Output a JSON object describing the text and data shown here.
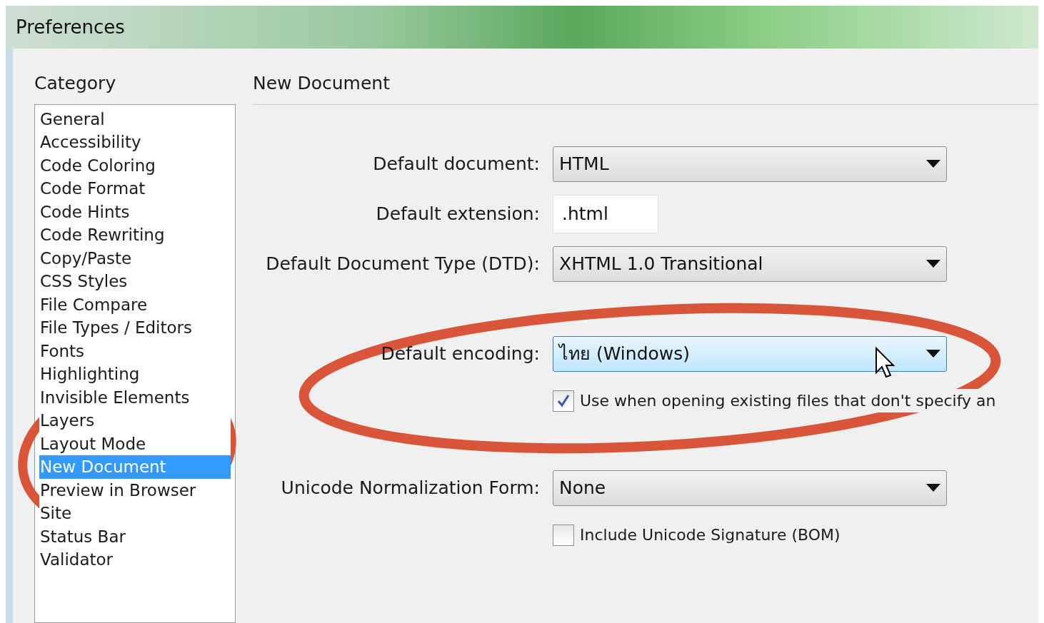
{
  "window": {
    "title": "Preferences"
  },
  "category": {
    "heading": "Category",
    "items": [
      {
        "label": "General",
        "selected": false
      },
      {
        "label": "Accessibility",
        "selected": false
      },
      {
        "label": "Code Coloring",
        "selected": false
      },
      {
        "label": "Code Format",
        "selected": false
      },
      {
        "label": "Code Hints",
        "selected": false
      },
      {
        "label": "Code Rewriting",
        "selected": false
      },
      {
        "label": "Copy/Paste",
        "selected": false
      },
      {
        "label": "CSS Styles",
        "selected": false
      },
      {
        "label": "File Compare",
        "selected": false
      },
      {
        "label": "File Types / Editors",
        "selected": false
      },
      {
        "label": "Fonts",
        "selected": false
      },
      {
        "label": "Highlighting",
        "selected": false
      },
      {
        "label": "Invisible Elements",
        "selected": false
      },
      {
        "label": "Layers",
        "selected": false
      },
      {
        "label": "Layout Mode",
        "selected": false
      },
      {
        "label": "New Document",
        "selected": true
      },
      {
        "label": "Preview in Browser",
        "selected": false
      },
      {
        "label": "Site",
        "selected": false
      },
      {
        "label": "Status Bar",
        "selected": false
      },
      {
        "label": "Validator",
        "selected": false
      }
    ]
  },
  "panel": {
    "heading": "New Document",
    "rows": [
      {
        "kind": "select",
        "label": "Default document:",
        "value": "HTML",
        "highlighted": false
      },
      {
        "kind": "text",
        "label": "Default extension:",
        "value": ".html"
      },
      {
        "kind": "select",
        "label": "Default Document Type (DTD):",
        "value": "XHTML 1.0 Transitional",
        "highlighted": false
      },
      {
        "kind": "gap"
      },
      {
        "kind": "select",
        "label": "Default encoding:",
        "value": "ไทย (Windows)",
        "highlighted": true
      },
      {
        "kind": "checkbox",
        "label": "Use when opening existing files that don't specify an",
        "checked": true
      },
      {
        "kind": "gap"
      },
      {
        "kind": "select",
        "label": "Unicode Normalization Form:",
        "value": "None",
        "highlighted": false
      },
      {
        "kind": "checkbox",
        "label": "Include Unicode Signature (BOM)",
        "checked": false
      }
    ]
  }
}
